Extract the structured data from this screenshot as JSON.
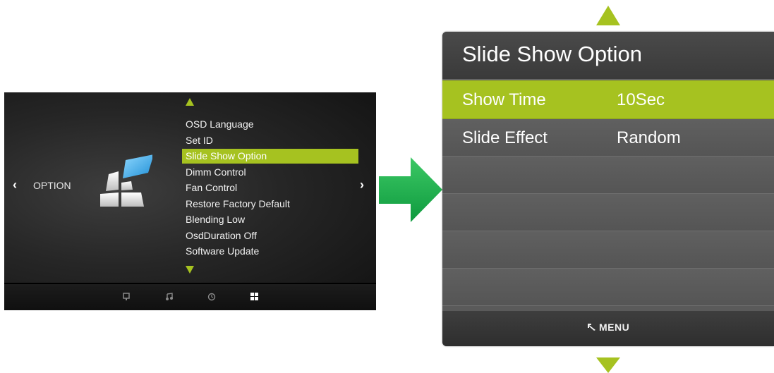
{
  "osd": {
    "category_label": "OPTION",
    "category_icon": "option-blocks-icon",
    "prev_glyph": "‹",
    "next_glyph": "›",
    "items": [
      {
        "label": "OSD Language"
      },
      {
        "label": "Set ID"
      },
      {
        "label": "Slide Show Option",
        "selected": true
      },
      {
        "label": "Dimm Control"
      },
      {
        "label": "Fan Control"
      },
      {
        "label": "Restore Factory Default"
      },
      {
        "label": "Blending Low"
      },
      {
        "label": "OsdDuration Off"
      },
      {
        "label": "Software Update"
      }
    ],
    "bottom_icons": [
      "monitor-icon",
      "music-icon",
      "clock-icon",
      "option-grid-icon"
    ]
  },
  "panel": {
    "title": "Slide Show Option",
    "rows": [
      {
        "key": "Show Time",
        "value": "10Sec",
        "selected": true
      },
      {
        "key": "Slide Effect",
        "value": "Random"
      }
    ],
    "footer_label": "MENU",
    "footer_icon": "return-icon"
  },
  "colors": {
    "accent": "#a6c220",
    "arrow_green": "#1aa64a",
    "panel_bg": "#5a5a5a",
    "osd_bg": "#1e1e1e"
  }
}
